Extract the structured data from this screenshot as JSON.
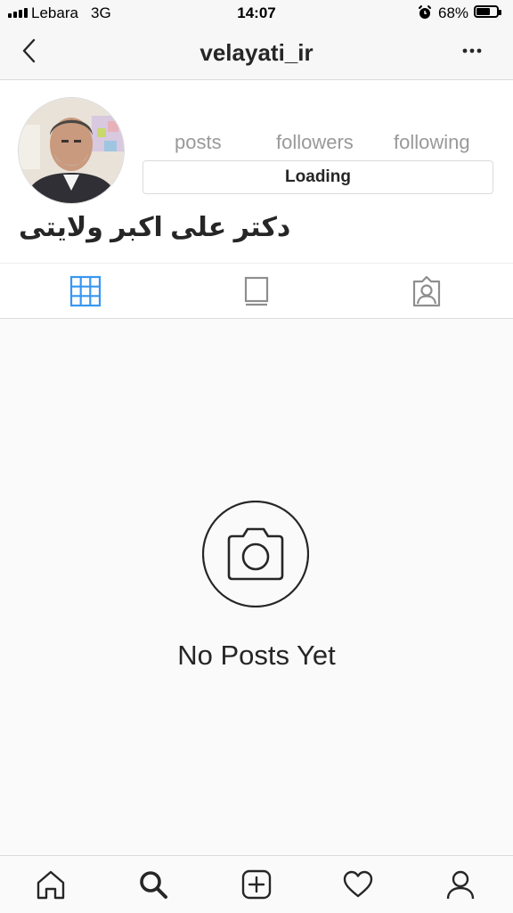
{
  "status_bar": {
    "carrier": "Lebara",
    "network": "3G",
    "time": "14:07",
    "battery_percent": "68%",
    "icons": [
      "signal-bars-icon",
      "alarm-clock-icon",
      "battery-icon"
    ]
  },
  "nav": {
    "username": "velayati_ir",
    "back_icon": "chevron-left-icon",
    "more_icon": "more-horizontal-icon"
  },
  "profile": {
    "full_name": "دکتر علی اکبر ولایتی",
    "stats": {
      "posts_label": "posts",
      "followers_label": "followers",
      "following_label": "following"
    },
    "button_label": "Loading"
  },
  "tabs": [
    {
      "icon": "grid-icon",
      "active": true
    },
    {
      "icon": "list-feed-icon",
      "active": false
    },
    {
      "icon": "tagged-person-icon",
      "active": false
    }
  ],
  "empty_state": {
    "icon": "camera-icon",
    "text": "No Posts Yet"
  },
  "bottom_nav": [
    {
      "icon": "home-icon",
      "active": false
    },
    {
      "icon": "search-icon",
      "active": true
    },
    {
      "icon": "new-post-icon",
      "active": false
    },
    {
      "icon": "heart-icon",
      "active": false
    },
    {
      "icon": "profile-icon",
      "active": false
    }
  ],
  "colors": {
    "active_tab": "#3897f0",
    "inactive_icon": "#8e8e8e",
    "text": "#262626",
    "muted_text": "#999999",
    "border": "#dbdbdb"
  }
}
